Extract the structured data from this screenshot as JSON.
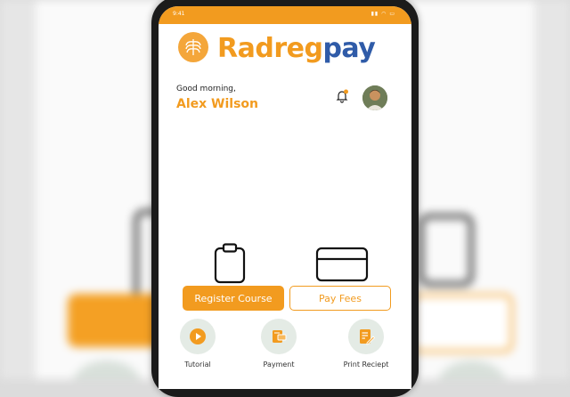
{
  "status_bar": {
    "time": "9:41",
    "icons": [
      "signal-icon",
      "wifi-icon",
      "battery-icon"
    ]
  },
  "brand": {
    "part1": "Radreg",
    "part2": "pay",
    "primary_color": "#f29b1f",
    "secondary_color": "#2f5ba8"
  },
  "header": {
    "greeting": "Good morning,",
    "user_name": "Alex Wilson",
    "has_notification": true
  },
  "actions": {
    "register_label": "Register Course",
    "pay_label": "Pay Fees"
  },
  "quick_actions": [
    {
      "label": "Tutorial",
      "icon": "play-icon"
    },
    {
      "label": "Payment",
      "icon": "payment-icon"
    },
    {
      "label": "Print Reciept",
      "icon": "receipt-icon"
    }
  ]
}
